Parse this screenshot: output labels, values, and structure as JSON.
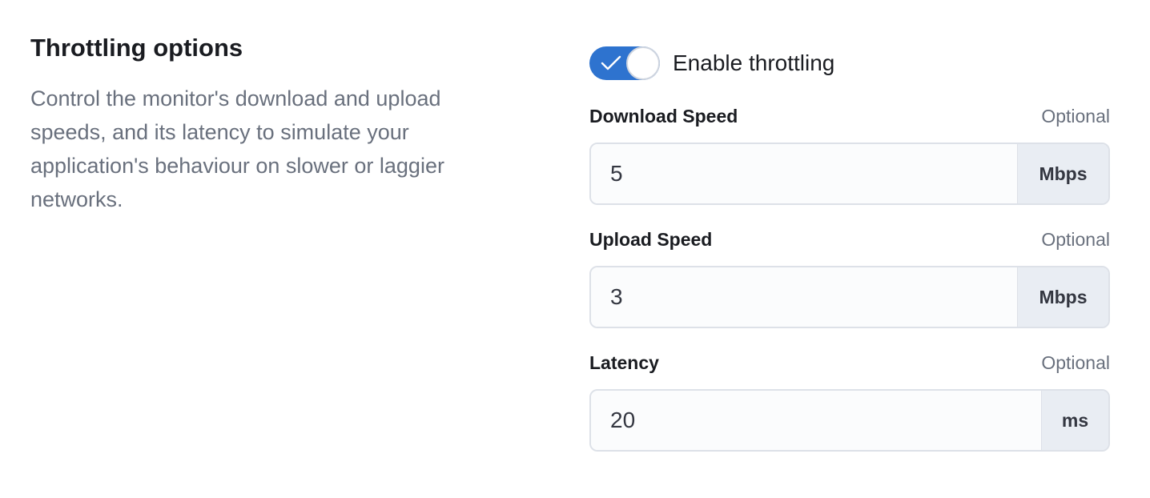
{
  "section": {
    "title": "Throttling options",
    "description": "Control the monitor's download and upload speeds, and its latency to simulate your application's behaviour on slower or laggier networks."
  },
  "toggle": {
    "label": "Enable throttling",
    "enabled": true,
    "icon": "check-icon",
    "accent_color": "#2e73cf"
  },
  "fields": [
    {
      "label": "Download Speed",
      "optional": "Optional",
      "value": "5",
      "unit": "Mbps"
    },
    {
      "label": "Upload Speed",
      "optional": "Optional",
      "value": "3",
      "unit": "Mbps"
    },
    {
      "label": "Latency",
      "optional": "Optional",
      "value": "20",
      "unit": "ms"
    }
  ]
}
